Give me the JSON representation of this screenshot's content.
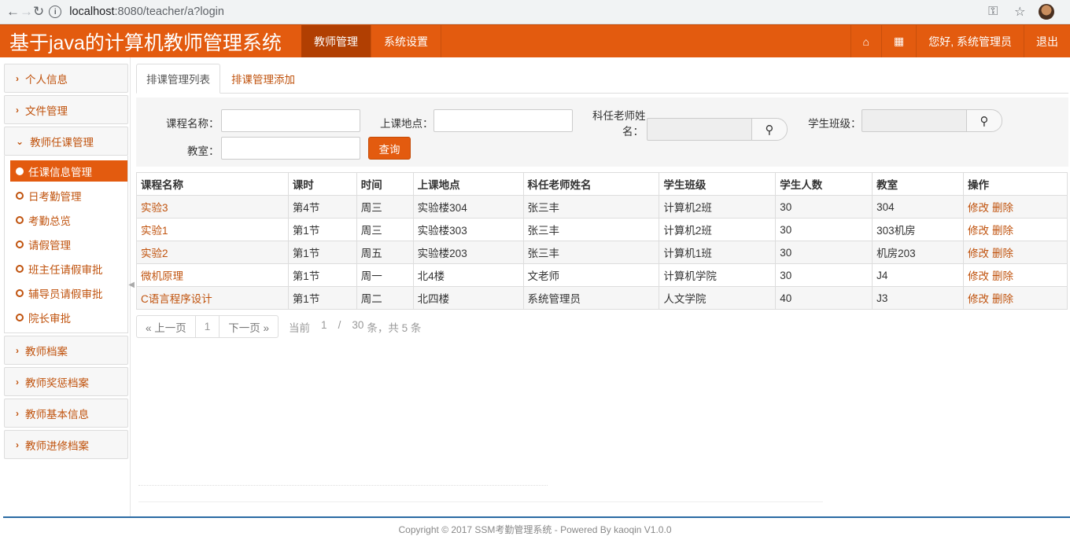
{
  "browser": {
    "url_host": "localhost",
    "url_rest": ":8080/teacher/a?login",
    "back_icon": "←",
    "forward_icon": "→",
    "reload_icon": "↻",
    "info_icon": "i",
    "key_icon": "⚿",
    "star_icon": "☆",
    "menu_icon": "⋮"
  },
  "header": {
    "title": "基于java的计算机教师管理系统",
    "nav": [
      {
        "label": "教师管理",
        "active": true
      },
      {
        "label": "系统设置",
        "active": false
      }
    ],
    "home_icon": "⌂",
    "grid_icon": "▦",
    "greeting": "您好, 系统管理员",
    "logout": "退出"
  },
  "sidebar": {
    "groups_top": [
      {
        "label": "个人信息"
      },
      {
        "label": "文件管理"
      }
    ],
    "open_group": {
      "label": "教师任课管理",
      "items": [
        {
          "label": "任课信息管理",
          "active": true
        },
        {
          "label": "日考勤管理",
          "active": false
        },
        {
          "label": "考勤总览",
          "active": false
        },
        {
          "label": "请假管理",
          "active": false
        },
        {
          "label": "班主任请假审批",
          "active": false
        },
        {
          "label": "辅导员请假审批",
          "active": false
        },
        {
          "label": "院长审批",
          "active": false
        }
      ]
    },
    "groups_bottom": [
      {
        "label": "教师档案"
      },
      {
        "label": "教师奖惩档案"
      },
      {
        "label": "教师基本信息"
      },
      {
        "label": "教师进修档案"
      }
    ]
  },
  "tabs": [
    {
      "label": "排课管理列表",
      "active": true
    },
    {
      "label": "排课管理添加",
      "active": false
    }
  ],
  "filter": {
    "course_label": "课程名称：",
    "location_label": "上课地点：",
    "teacher_label_1": "科任老师姓",
    "teacher_label_2": "名：",
    "class_label": "学生班级：",
    "room_label": "教室：",
    "query_button": "查询",
    "search_icon": "⚲"
  },
  "table": {
    "headers": [
      "课程名称",
      "课时",
      "时间",
      "上课地点",
      "科任老师姓名",
      "学生班级",
      "学生人数",
      "教室",
      "操作"
    ],
    "edit_label": "修改",
    "delete_label": "删除",
    "rows": [
      [
        "实验3",
        "第4节",
        "周三",
        "实验楼304",
        "张三丰",
        "计算机2班",
        "30",
        "304"
      ],
      [
        "实验1",
        "第1节",
        "周三",
        "实验楼303",
        "张三丰",
        "计算机2班",
        "30",
        "303机房"
      ],
      [
        "实验2",
        "第1节",
        "周五",
        "实验楼203",
        "张三丰",
        "计算机1班",
        "30",
        "机房203"
      ],
      [
        "微机原理",
        "第1节",
        "周一",
        "北4楼",
        "文老师",
        "计算机学院",
        "30",
        "J4"
      ],
      [
        "C语言程序设计",
        "第1节",
        "周二",
        "北四楼",
        "系统管理员",
        "人文学院",
        "40",
        "J3"
      ]
    ]
  },
  "pager": {
    "prev": "« 上一页",
    "page": "1",
    "next": "下一页 »",
    "info_prefix": "当前",
    "current": "1",
    "sep": "/",
    "per": "30",
    "info_suffix": "条，共 5 条"
  },
  "footer": {
    "copyright": "Copyright © 2017 SSM考勤管理系统 - Powered By kaoqin V1.0.0"
  },
  "colors": {
    "brand": "#e35b0f",
    "brand_dark": "#b13f02",
    "link": "#c0530e"
  }
}
